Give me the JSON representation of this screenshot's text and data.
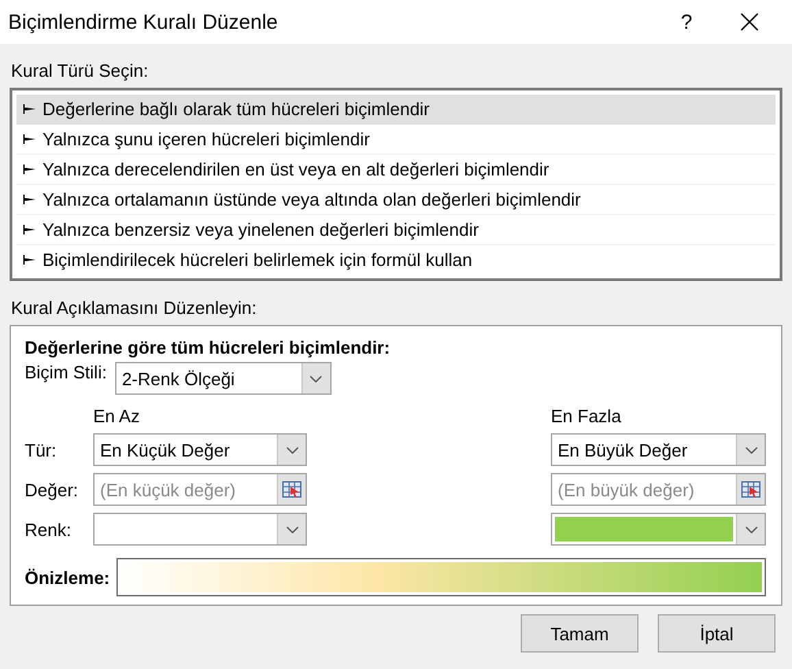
{
  "window": {
    "title": "Biçimlendirme Kuralı Düzenle",
    "help": "?"
  },
  "rule_type": {
    "label": "Kural Türü Seçin:",
    "items": [
      {
        "label": "Değerlerine bağlı olarak tüm hücreleri biçimlendir",
        "selected": true
      },
      {
        "label": "Yalnızca şunu içeren hücreleri biçimlendir",
        "selected": false
      },
      {
        "label": "Yalnızca derecelendirilen en üst veya en alt değerleri biçimlendir",
        "selected": false
      },
      {
        "label": "Yalnızca ortalamanın üstünde veya altında olan değerleri biçimlendir",
        "selected": false
      },
      {
        "label": "Yalnızca benzersiz veya yinelenen değerleri biçimlendir",
        "selected": false
      },
      {
        "label": "Biçimlendirilecek hücreleri belirlemek için formül kullan",
        "selected": false
      }
    ]
  },
  "description": {
    "label": "Kural Açıklamasını Düzenleyin:",
    "heading": "Değerlerine göre tüm hücreleri biçimlendir:",
    "style_label": "Biçim Stili:",
    "style_value": "2-Renk Ölçeği",
    "row_labels": [
      "Tür:",
      "Değer:",
      "Renk:"
    ],
    "ends": [
      {
        "header": "En Az",
        "type": "En Küçük Değer",
        "value_placeholder": "(En küçük değer)"
      },
      {
        "header": "En Fazla",
        "type": "En Büyük Değer",
        "value_placeholder": "(En büyük değer)",
        "color": "#92d050"
      }
    ],
    "preview_label": "Önizleme:"
  },
  "buttons": [
    "Tamam",
    "İptal"
  ]
}
